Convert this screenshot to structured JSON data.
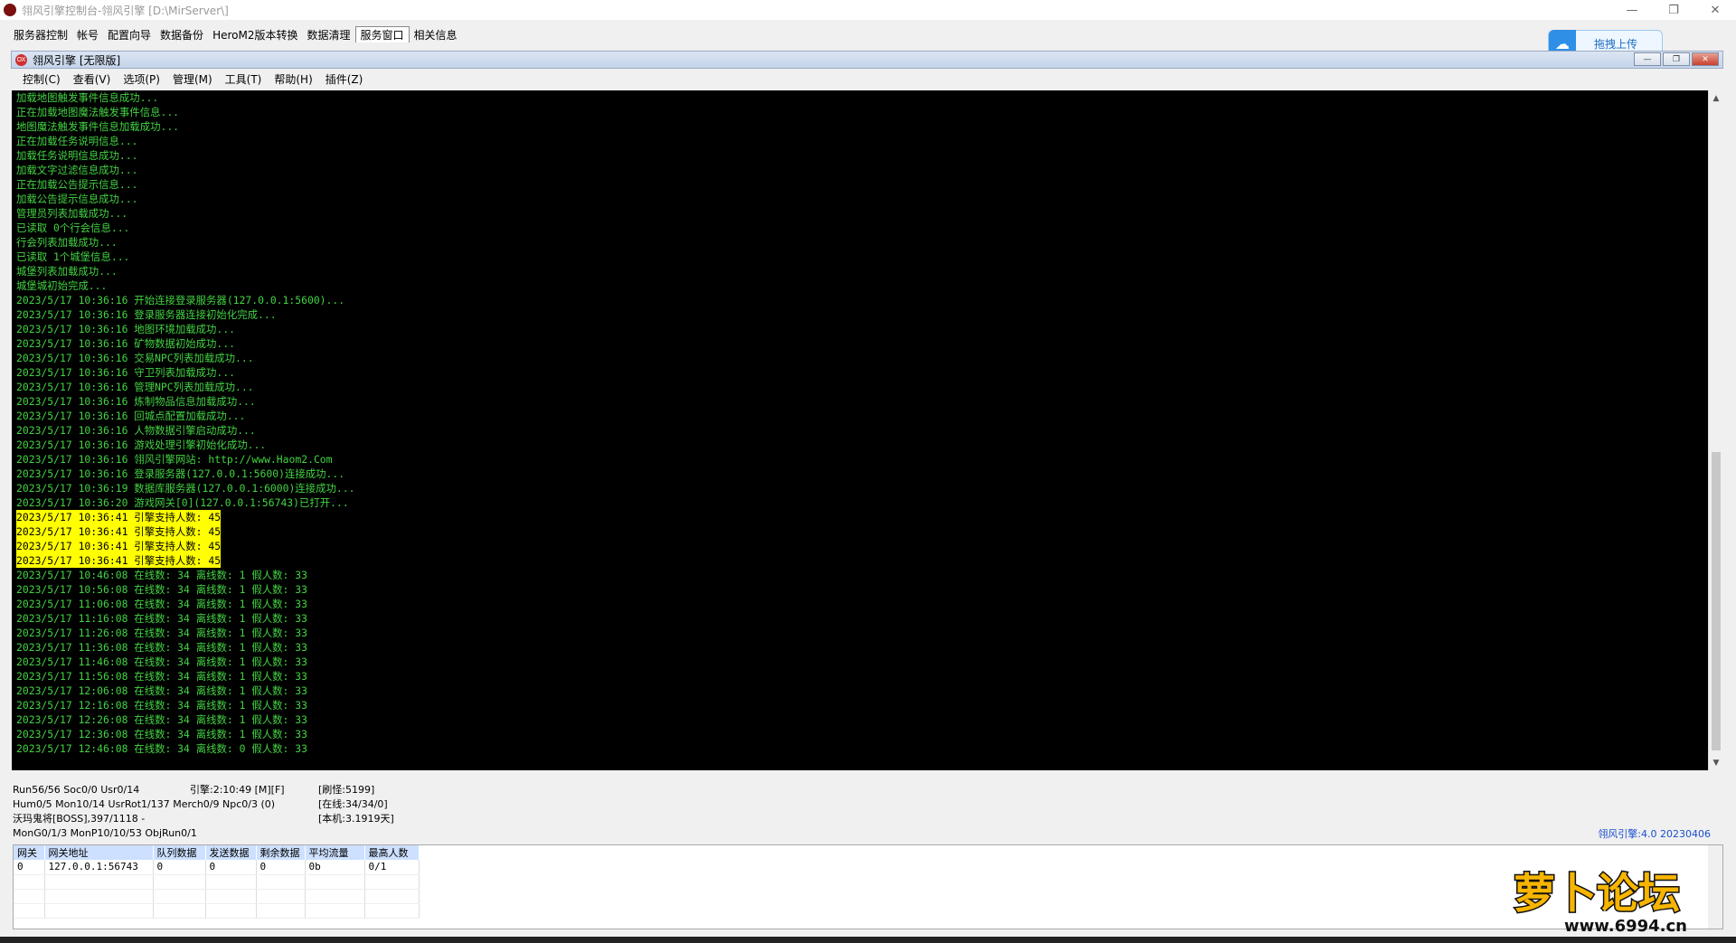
{
  "window": {
    "title": "翎风引擎控制台-翎风引擎 [D:\\MirServer\\]",
    "controls": [
      "—",
      "❐",
      "✕"
    ]
  },
  "outer_tabs": [
    "服务器控制",
    "帐号",
    "配置向导",
    "数据备份",
    "HeroM2版本转换",
    "数据清理",
    "服务窗口",
    "相关信息"
  ],
  "upload": {
    "label": "拖拽上传"
  },
  "inner": {
    "title": "翎风引擎 [无限版]",
    "icon_text": "OX"
  },
  "menu": [
    "控制(C)",
    "查看(V)",
    "选项(P)",
    "管理(M)",
    "工具(T)",
    "帮助(H)",
    "插件(Z)"
  ],
  "console": {
    "lines": [
      {
        "text": "加载地图触发事件信息成功...",
        "hl": false
      },
      {
        "text": "正在加载地图魔法触发事件信息...",
        "hl": false
      },
      {
        "text": "地图魔法触发事件信息加载成功...",
        "hl": false
      },
      {
        "text": "正在加载任务说明信息...",
        "hl": false
      },
      {
        "text": "加载任务说明信息成功...",
        "hl": false
      },
      {
        "text": "加载文字过滤信息成功...",
        "hl": false
      },
      {
        "text": "正在加载公告提示信息...",
        "hl": false
      },
      {
        "text": "加载公告提示信息成功...",
        "hl": false
      },
      {
        "text": "管理员列表加载成功...",
        "hl": false
      },
      {
        "text": "已读取 0个行会信息...",
        "hl": false
      },
      {
        "text": "行会列表加载成功...",
        "hl": false
      },
      {
        "text": "已读取 1个城堡信息...",
        "hl": false
      },
      {
        "text": "城堡列表加载成功...",
        "hl": false
      },
      {
        "text": "城堡城初始完成...",
        "hl": false
      },
      {
        "text": "2023/5/17 10:36:16 开始连接登录服务器(127.0.0.1:5600)...",
        "hl": false
      },
      {
        "text": "2023/5/17 10:36:16 登录服务器连接初始化完成...",
        "hl": false
      },
      {
        "text": "2023/5/17 10:36:16 地图环境加载成功...",
        "hl": false
      },
      {
        "text": "2023/5/17 10:36:16 矿物数据初始成功...",
        "hl": false
      },
      {
        "text": "2023/5/17 10:36:16 交易NPC列表加载成功...",
        "hl": false
      },
      {
        "text": "2023/5/17 10:36:16 守卫列表加载成功...",
        "hl": false
      },
      {
        "text": "2023/5/17 10:36:16 管理NPC列表加载成功...",
        "hl": false
      },
      {
        "text": "2023/5/17 10:36:16 炼制物品信息加载成功...",
        "hl": false
      },
      {
        "text": "2023/5/17 10:36:16 回城点配置加载成功...",
        "hl": false
      },
      {
        "text": "2023/5/17 10:36:16 人物数据引擎启动成功...",
        "hl": false
      },
      {
        "text": "2023/5/17 10:36:16 游戏处理引擎初始化成功...",
        "hl": false
      },
      {
        "text": "2023/5/17 10:36:16 翎风引擎网站: http://www.Haom2.Com",
        "hl": false
      },
      {
        "text": "2023/5/17 10:36:16 登录服务器(127.0.0.1:5600)连接成功...",
        "hl": false
      },
      {
        "text": "2023/5/17 10:36:19 数据库服务器(127.0.0.1:6000)连接成功...",
        "hl": false
      },
      {
        "text": "2023/5/17 10:36:20 游戏网关[0](127.0.0.1:56743)已打开...",
        "hl": false
      },
      {
        "text": "2023/5/17 10:36:41 引擎支持人数: 45",
        "hl": true
      },
      {
        "text": "2023/5/17 10:36:41 引擎支持人数: 45",
        "hl": true
      },
      {
        "text": "2023/5/17 10:36:41 引擎支持人数: 45",
        "hl": true
      },
      {
        "text": "2023/5/17 10:36:41 引擎支持人数: 45",
        "hl": true
      },
      {
        "text": "2023/5/17 10:46:08 在线数: 34 离线数: 1 假人数: 33",
        "hl": false
      },
      {
        "text": "2023/5/17 10:56:08 在线数: 34 离线数: 1 假人数: 33",
        "hl": false
      },
      {
        "text": "2023/5/17 11:06:08 在线数: 34 离线数: 1 假人数: 33",
        "hl": false
      },
      {
        "text": "2023/5/17 11:16:08 在线数: 34 离线数: 1 假人数: 33",
        "hl": false
      },
      {
        "text": "2023/5/17 11:26:08 在线数: 34 离线数: 1 假人数: 33",
        "hl": false
      },
      {
        "text": "2023/5/17 11:36:08 在线数: 34 离线数: 1 假人数: 33",
        "hl": false
      },
      {
        "text": "2023/5/17 11:46:08 在线数: 34 离线数: 1 假人数: 33",
        "hl": false
      },
      {
        "text": "2023/5/17 11:56:08 在线数: 34 离线数: 1 假人数: 33",
        "hl": false
      },
      {
        "text": "2023/5/17 12:06:08 在线数: 34 离线数: 1 假人数: 33",
        "hl": false
      },
      {
        "text": "2023/5/17 12:16:08 在线数: 34 离线数: 1 假人数: 33",
        "hl": false
      },
      {
        "text": "2023/5/17 12:26:08 在线数: 34 离线数: 1 假人数: 33",
        "hl": false
      },
      {
        "text": "2023/5/17 12:36:08 在线数: 34 离线数: 1 假人数: 33",
        "hl": false
      },
      {
        "text": "2023/5/17 12:46:08 在线数: 34 离线数: 0 假人数: 33",
        "hl": false
      }
    ]
  },
  "status": {
    "r1a": "Run56/56 Soc0/0 Usr0/14",
    "r1b": "引擎:2:10:49 [M][F]",
    "r1c": "[刷怪:5199]",
    "r2a": "Hum0/5 Mon10/14 UsrRot1/137 Merch0/9 Npc0/3 (0)",
    "r2c": "[在线:34/34/0]",
    "r3a": "沃玛鬼将[BOSS],397/1118 -",
    "r3c": "[本机:3.1919天]",
    "r4a": "MonG0/1/3 MonP10/10/53 ObjRun0/1",
    "version": "翎风引擎:4.0 20230406"
  },
  "table": {
    "headers": [
      "网关",
      "网关地址",
      "队列数据",
      "发送数据",
      "剩余数据",
      "平均流量",
      "最高人数"
    ],
    "rows": [
      [
        "0",
        "127.0.0.1:56743",
        "0",
        "0",
        "0",
        "0b",
        "0/1"
      ]
    ]
  },
  "watermark": {
    "main": "萝卜论坛",
    "url": "www.6994.cn"
  },
  "colors": {
    "console_bg": "#000000",
    "console_text": "#43d343",
    "highlight": "#ffff00",
    "header_bg": "#cde0ff"
  }
}
